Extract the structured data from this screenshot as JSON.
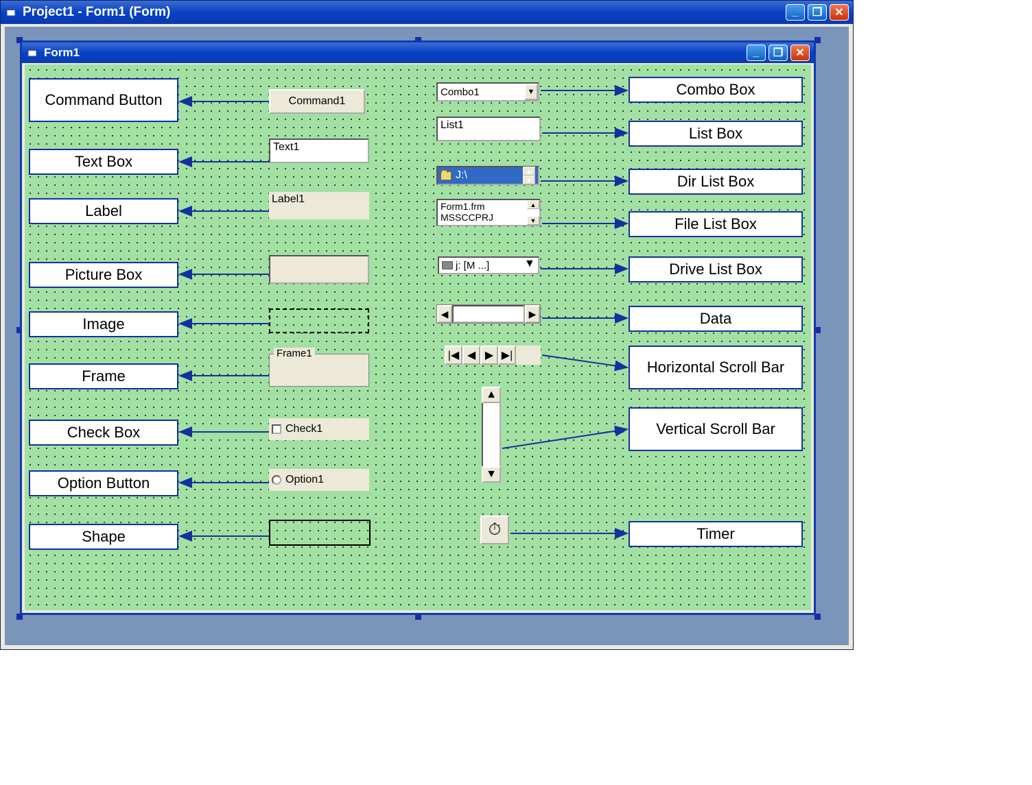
{
  "outer_window": {
    "title": "Project1 - Form1 (Form)"
  },
  "inner_window": {
    "title": "Form1"
  },
  "labels_left": {
    "command_button": "Command Button",
    "text_box": "Text Box",
    "label": "Label",
    "picture_box": "Picture Box",
    "image": "Image",
    "frame": "Frame",
    "check_box": "Check Box",
    "option_button": "Option Button",
    "shape": "Shape"
  },
  "labels_right": {
    "combo_box": "Combo Box",
    "list_box": "List Box",
    "dir_list_box": "Dir List Box",
    "file_list_box": "File List Box",
    "drive_list_box": "Drive List Box",
    "data": "Data",
    "hscroll": "Horizontal Scroll Bar",
    "vscroll": "Vertical Scroll Bar",
    "timer": "Timer"
  },
  "controls": {
    "command_caption": "Command1",
    "textbox_value": "Text1",
    "label_caption": "Label1",
    "frame_caption": "Frame1",
    "check_caption": "Check1",
    "option_caption": "Option1",
    "combo_value": "Combo1",
    "listbox_value": "List1",
    "dirlist_path": "J:\\",
    "filelist_items": [
      "Form1.frm",
      "MSSCCPRJ"
    ],
    "drive_value": "j: [M ...]"
  }
}
